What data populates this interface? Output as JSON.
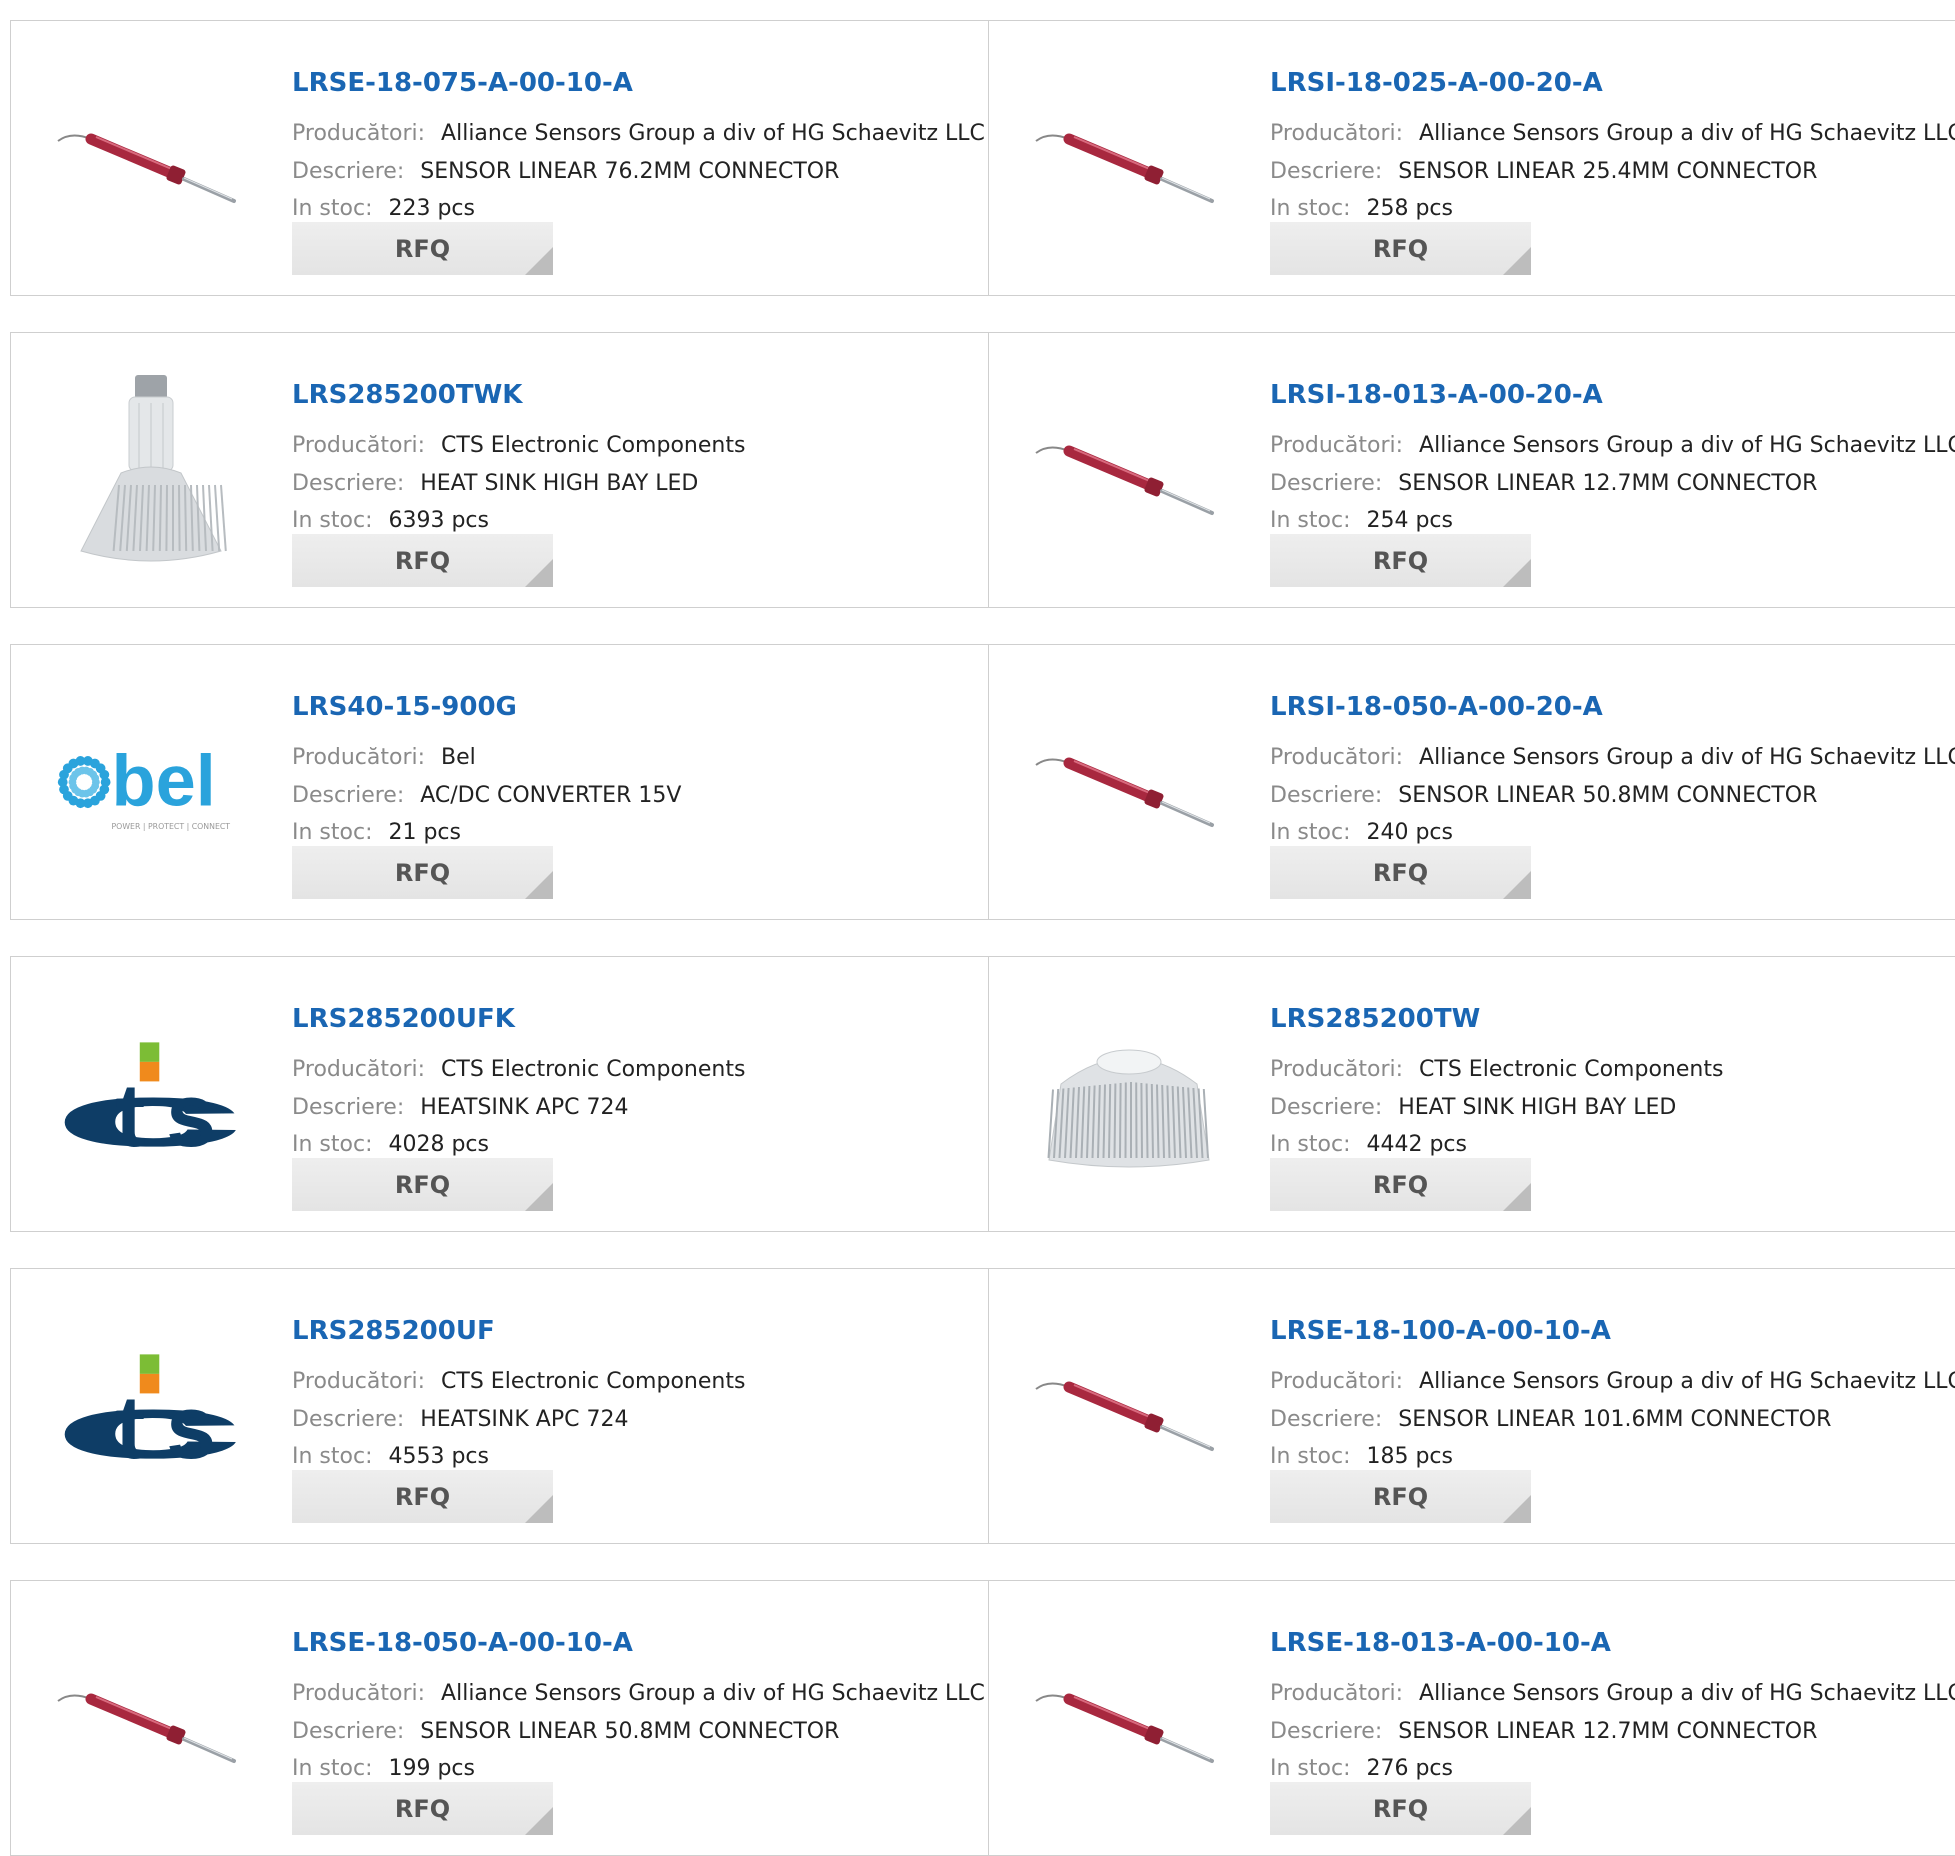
{
  "labels": {
    "manufacturer": "Producători:",
    "description": "Descriere:",
    "stock": "In stoc:",
    "rfq": "RFQ"
  },
  "products": [
    {
      "part": "LRSE-18-075-A-00-10-A",
      "manufacturer": "Alliance Sensors Group a div of HG Schaevitz LLC",
      "description": "SENSOR LINEAR 76.2MM CONNECTOR",
      "stock": "223 pcs",
      "image": "linear-sensor"
    },
    {
      "part": "LRSI-18-025-A-00-20-A",
      "manufacturer": "Alliance Sensors Group a div of HG Schaevitz LLC",
      "description": "SENSOR LINEAR 25.4MM CONNECTOR",
      "stock": "258 pcs",
      "image": "linear-sensor"
    },
    {
      "part": "LRS285200TWK",
      "manufacturer": "CTS Electronic Components",
      "description": "HEAT SINK HIGH BAY LED",
      "stock": "6393 pcs",
      "image": "heatsink-tall"
    },
    {
      "part": "LRSI-18-013-A-00-20-A",
      "manufacturer": "Alliance Sensors Group a div of HG Schaevitz LLC",
      "description": "SENSOR LINEAR 12.7MM CONNECTOR",
      "stock": "254 pcs",
      "image": "linear-sensor"
    },
    {
      "part": "LRS40-15-900G",
      "manufacturer": "Bel",
      "description": "AC/DC CONVERTER 15V",
      "stock": "21 pcs",
      "image": "bel-logo",
      "logo_text": "bel",
      "logo_tagline": "POWER | PROTECT | CONNECT"
    },
    {
      "part": "LRSI-18-050-A-00-20-A",
      "manufacturer": "Alliance Sensors Group a div of HG Schaevitz LLC",
      "description": "SENSOR LINEAR 50.8MM CONNECTOR",
      "stock": "240 pcs",
      "image": "linear-sensor"
    },
    {
      "part": "LRS285200UFK",
      "manufacturer": "CTS Electronic Components",
      "description": "HEATSINK APC 724",
      "stock": "4028 pcs",
      "image": "cts-logo",
      "logo_text": "CTS"
    },
    {
      "part": "LRS285200TW",
      "manufacturer": "CTS Electronic Components",
      "description": "HEAT SINK HIGH BAY LED",
      "stock": "4442 pcs",
      "image": "heatsink-wide"
    },
    {
      "part": "LRS285200UF",
      "manufacturer": "CTS Electronic Components",
      "description": "HEATSINK APC 724",
      "stock": "4553 pcs",
      "image": "cts-logo",
      "logo_text": "CTS"
    },
    {
      "part": "LRSE-18-100-A-00-10-A",
      "manufacturer": "Alliance Sensors Group a div of HG Schaevitz LLC",
      "description": "SENSOR LINEAR 101.6MM CONNECTOR",
      "stock": "185 pcs",
      "image": "linear-sensor"
    },
    {
      "part": "LRSE-18-050-A-00-10-A",
      "manufacturer": "Alliance Sensors Group a div of HG Schaevitz LLC",
      "description": "SENSOR LINEAR 50.8MM CONNECTOR",
      "stock": "199 pcs",
      "image": "linear-sensor"
    },
    {
      "part": "LRSE-18-013-A-00-10-A",
      "manufacturer": "Alliance Sensors Group a div of HG Schaevitz LLC",
      "description": "SENSOR LINEAR 12.7MM CONNECTOR",
      "stock": "276 pcs",
      "image": "linear-sensor"
    }
  ],
  "colors": {
    "part_link": "#1a66b3",
    "label": "#8a8a8a",
    "value": "#222222",
    "border": "#cfcfcf",
    "rfq_bg": "#e9e9e9",
    "bel_blue": "#2aa3dc",
    "cts_navy": "#0e3d66",
    "cts_orange": "#f08a1c",
    "cts_green": "#7cbd35",
    "sensor_red": "#a8283f"
  }
}
